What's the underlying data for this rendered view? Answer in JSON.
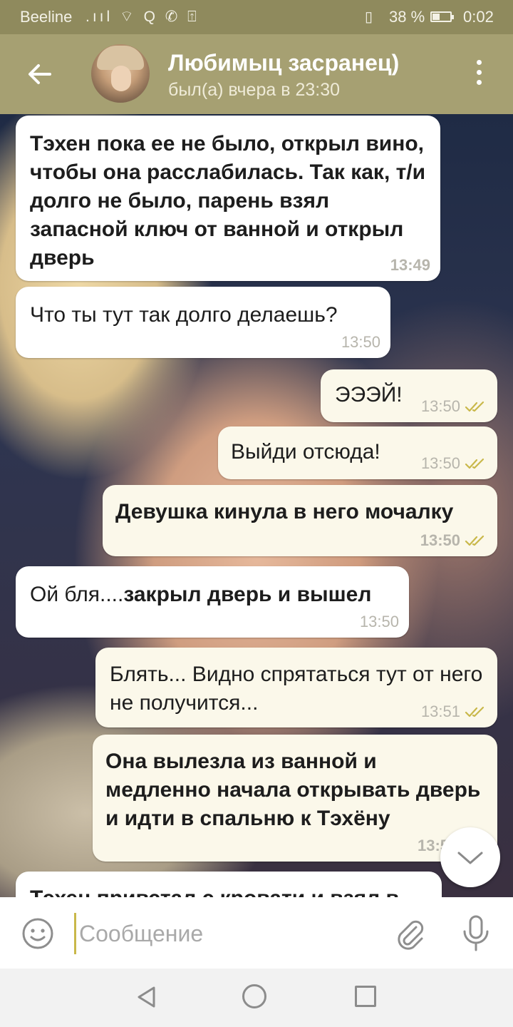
{
  "status_bar": {
    "carrier": "Beeline",
    "icons": ".ııl ⌔ Q ✆ ⍐",
    "vibrate": "▯",
    "battery": "38 %",
    "time": "0:02"
  },
  "header": {
    "title": "Любимыц засранец)",
    "subtitle": "был(а) вчера в 23:30"
  },
  "messages": [
    {
      "dir": "in",
      "text": "Тэхен пока ее не было, открыл вино, чтобы она расслабилась. Так как, т/и долго не было, парень взял запасной ключ от ванной и открыл дверь",
      "time": "13:49"
    },
    {
      "dir": "in",
      "text": "Что ты тут так долго делаешь?",
      "time": "13:50"
    },
    {
      "dir": "out",
      "text": "ЭЭЭЙ!",
      "time": "13:50"
    },
    {
      "dir": "out",
      "text": "Выйди отсюда!",
      "time": "13:50"
    },
    {
      "dir": "out",
      "text": "Девушка кинула в него мочалку",
      "time": "13:50"
    },
    {
      "dir": "in",
      "text_regular": "Ой бля....",
      "text_bold": "закрыл дверь и вышел",
      "time": "13:50"
    },
    {
      "dir": "out",
      "text": "Блять... Видно спрятаться тут от него не получится...",
      "time": "13:51"
    },
    {
      "dir": "out",
      "text": "Она вылезла из ванной и медленно начала открывать дверь и идти в спальню к Тэхёну",
      "time": "13:5"
    },
    {
      "dir": "in",
      "text": "Тэхен привстал с кровати и взял в",
      "time": ""
    }
  ],
  "composer": {
    "placeholder": "Сообщение"
  },
  "icons": {
    "back": "arrow-left-icon",
    "menu": "more-vertical-icon",
    "read": "double-check-icon",
    "scroll": "chevron-down-icon",
    "emoji": "smile-icon",
    "attach": "paperclip-icon",
    "mic": "microphone-icon"
  },
  "colors": {
    "header": "#a6a072",
    "status_bar": "#8f8a5d",
    "incoming_bubble": "#ffffff",
    "outgoing_bubble": "#fbf8ea",
    "check": "#c9b84a"
  }
}
